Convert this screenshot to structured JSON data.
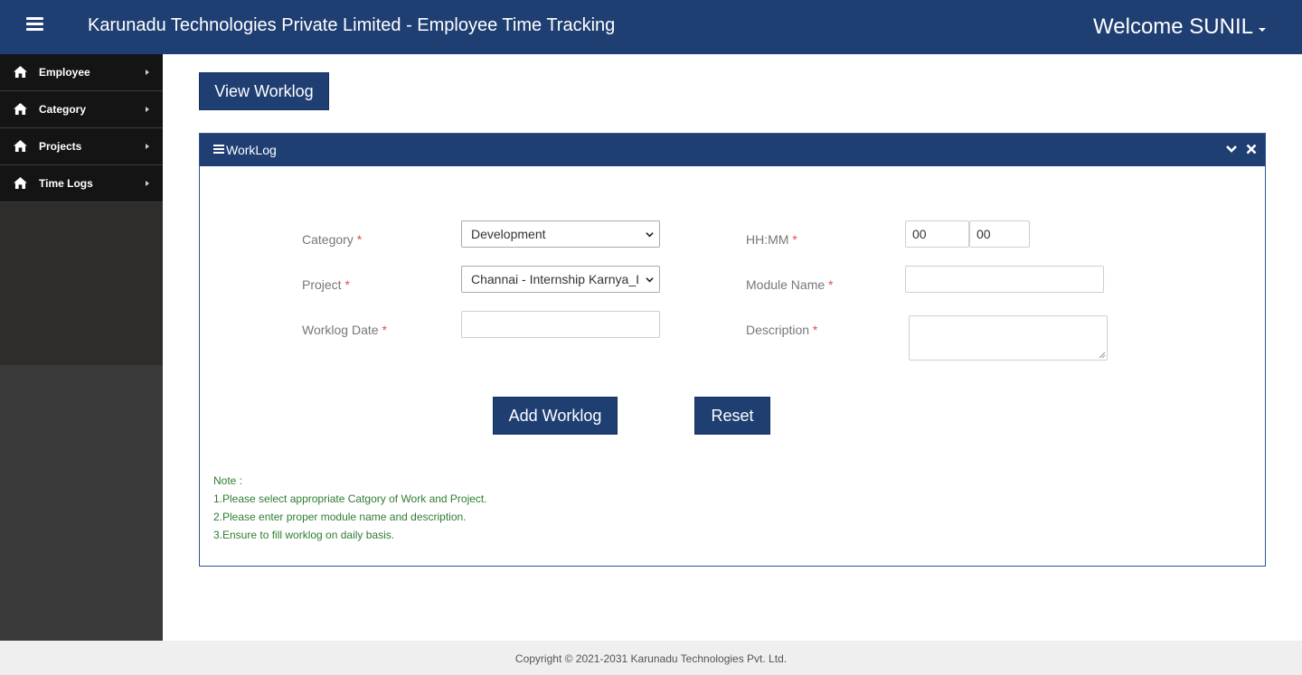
{
  "header": {
    "title": "Karunadu Technologies Private Limited - Employee Time Tracking",
    "welcome": "Welcome SUNIL"
  },
  "sidebar": {
    "items": [
      {
        "label": "Employee",
        "icon": "home-icon"
      },
      {
        "label": "Category",
        "icon": "home-icon"
      },
      {
        "label": "Projects",
        "icon": "home-icon"
      },
      {
        "label": "Time Logs",
        "icon": "home-icon"
      }
    ]
  },
  "main": {
    "view_worklog_label": "View Worklog"
  },
  "panel": {
    "title": "WorkLog",
    "icons": [
      "bars-icon",
      "chevron-down-icon",
      "close-icon"
    ]
  },
  "form": {
    "category": {
      "label": "Category",
      "required": "*",
      "value": "Development"
    },
    "project": {
      "label": "Project",
      "required": "*",
      "value": "Channai - Internship Karnya_I"
    },
    "worklog_date": {
      "label": "Worklog Date",
      "required": "*",
      "value": ""
    },
    "hhmm": {
      "label": "HH:MM",
      "required": "*",
      "hours": "00",
      "minutes": "00"
    },
    "module_name": {
      "label": "Module Name",
      "required": "*",
      "value": ""
    },
    "description": {
      "label": "Description",
      "required": "*",
      "value": ""
    },
    "add_label": "Add Worklog",
    "reset_label": "Reset"
  },
  "note": {
    "title": "Note :",
    "lines": [
      "1.Please select appropriate Catgory of Work and Project.",
      "2.Please enter proper module name and description.",
      "3.Ensure to fill worklog on daily basis."
    ]
  },
  "footer": {
    "copyright": "Copyright © 2021-2031 Karunadu Technologies Pvt. Ltd."
  },
  "colors": {
    "primary": "#1f3f73",
    "sidebar": "#141414",
    "note": "#2e7d32",
    "required": "#d9534f"
  }
}
